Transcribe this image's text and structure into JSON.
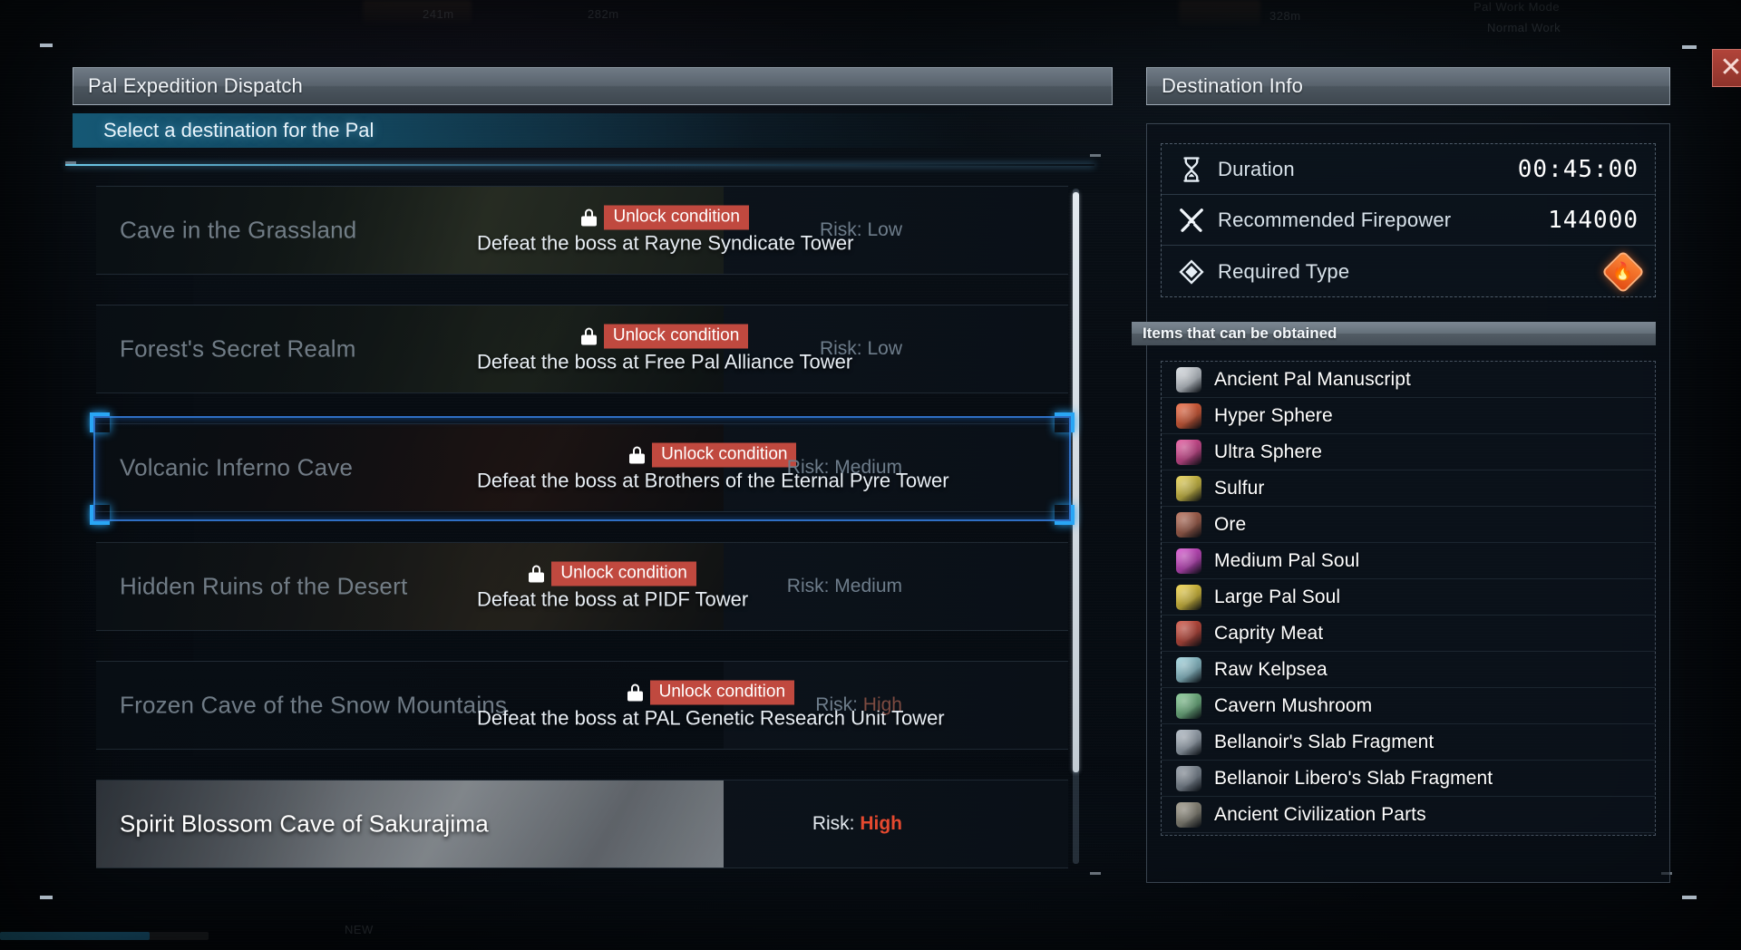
{
  "window": {
    "close_label": "✕"
  },
  "background_hud": {
    "distance_1": "241m",
    "distance_2": "282m",
    "distance_3": "328m",
    "pal_work_mode": "Pal Work Mode",
    "normal_work": "Normal Work",
    "new_badge": "NEW"
  },
  "left_panel": {
    "title": "Pal Expedition Dispatch",
    "subtitle": "Select a destination for the Pal",
    "risk_prefix": "Risk:",
    "unlock_badge_label": "Unlock condition",
    "destinations": [
      {
        "name": "Cave in the Grassland",
        "locked": true,
        "unlock_detail": "Defeat the boss at Rayne Syndicate Tower",
        "risk": "Low",
        "risk_level": "low"
      },
      {
        "name": "Forest's Secret Realm",
        "locked": true,
        "unlock_detail": "Defeat the boss at Free Pal Alliance Tower",
        "risk": "Low",
        "risk_level": "low"
      },
      {
        "name": "Volcanic Inferno Cave",
        "locked": true,
        "selected": true,
        "unlock_detail": "Defeat the boss at Brothers of the Eternal Pyre Tower",
        "risk": "Medium",
        "risk_level": "medium"
      },
      {
        "name": "Hidden Ruins of the Desert",
        "locked": true,
        "unlock_detail": "Defeat the boss at PIDF Tower",
        "risk": "Medium",
        "risk_level": "medium"
      },
      {
        "name": "Frozen Cave of the Snow Mountains",
        "locked": true,
        "unlock_detail": "Defeat the boss at PAL Genetic Research Unit Tower",
        "risk": "High",
        "risk_level": "high"
      },
      {
        "name": "Spirit Blossom Cave of Sakurajima",
        "locked": false,
        "unlock_detail": "",
        "risk": "High",
        "risk_level": "high"
      }
    ]
  },
  "right_panel": {
    "title": "Destination Info",
    "stats": [
      {
        "icon": "hourglass-icon",
        "label": "Duration",
        "value": "00:45:00"
      },
      {
        "icon": "crossed-swords-icon",
        "label": "Recommended Firepower",
        "value": "144000"
      },
      {
        "icon": "diamond-icon",
        "label": "Required Type",
        "value": "",
        "element": "fire"
      }
    ],
    "items_header": "Items that can be obtained",
    "items": [
      {
        "name": "Ancient Pal Manuscript",
        "icon": "scroll-icon",
        "color": "#d9dee3"
      },
      {
        "name": "Hyper Sphere",
        "icon": "sphere-icon",
        "color": "#f0663c"
      },
      {
        "name": "Ultra Sphere",
        "icon": "sphere-icon",
        "color": "#e8529d"
      },
      {
        "name": "Sulfur",
        "icon": "mineral-icon",
        "color": "#e8d24a"
      },
      {
        "name": "Ore",
        "icon": "ore-icon",
        "color": "#b66a52"
      },
      {
        "name": "Medium Pal Soul",
        "icon": "soul-icon",
        "color": "#d94fd0"
      },
      {
        "name": "Large Pal Soul",
        "icon": "soul-icon",
        "color": "#f2d441"
      },
      {
        "name": "Caprity Meat",
        "icon": "meat-icon",
        "color": "#d2503f"
      },
      {
        "name": "Raw Kelpsea",
        "icon": "fish-icon",
        "color": "#9fd6e0"
      },
      {
        "name": "Cavern Mushroom",
        "icon": "mushroom-icon",
        "color": "#7fc78e"
      },
      {
        "name": "Bellanoir's Slab Fragment",
        "icon": "slab-icon",
        "color": "#aeb8c2"
      },
      {
        "name": "Bellanoir Libero's Slab Fragment",
        "icon": "slab-icon",
        "color": "#8e97a1"
      },
      {
        "name": "Ancient Civilization Parts",
        "icon": "gear-part-icon",
        "color": "#9a9483"
      }
    ]
  },
  "colors": {
    "accent_blue": "#29a6f5",
    "select_border": "#2f6fc4",
    "risk_high": "#e5492f",
    "unlock_red": "#c0493f",
    "fire_orange": "#e14a12"
  }
}
